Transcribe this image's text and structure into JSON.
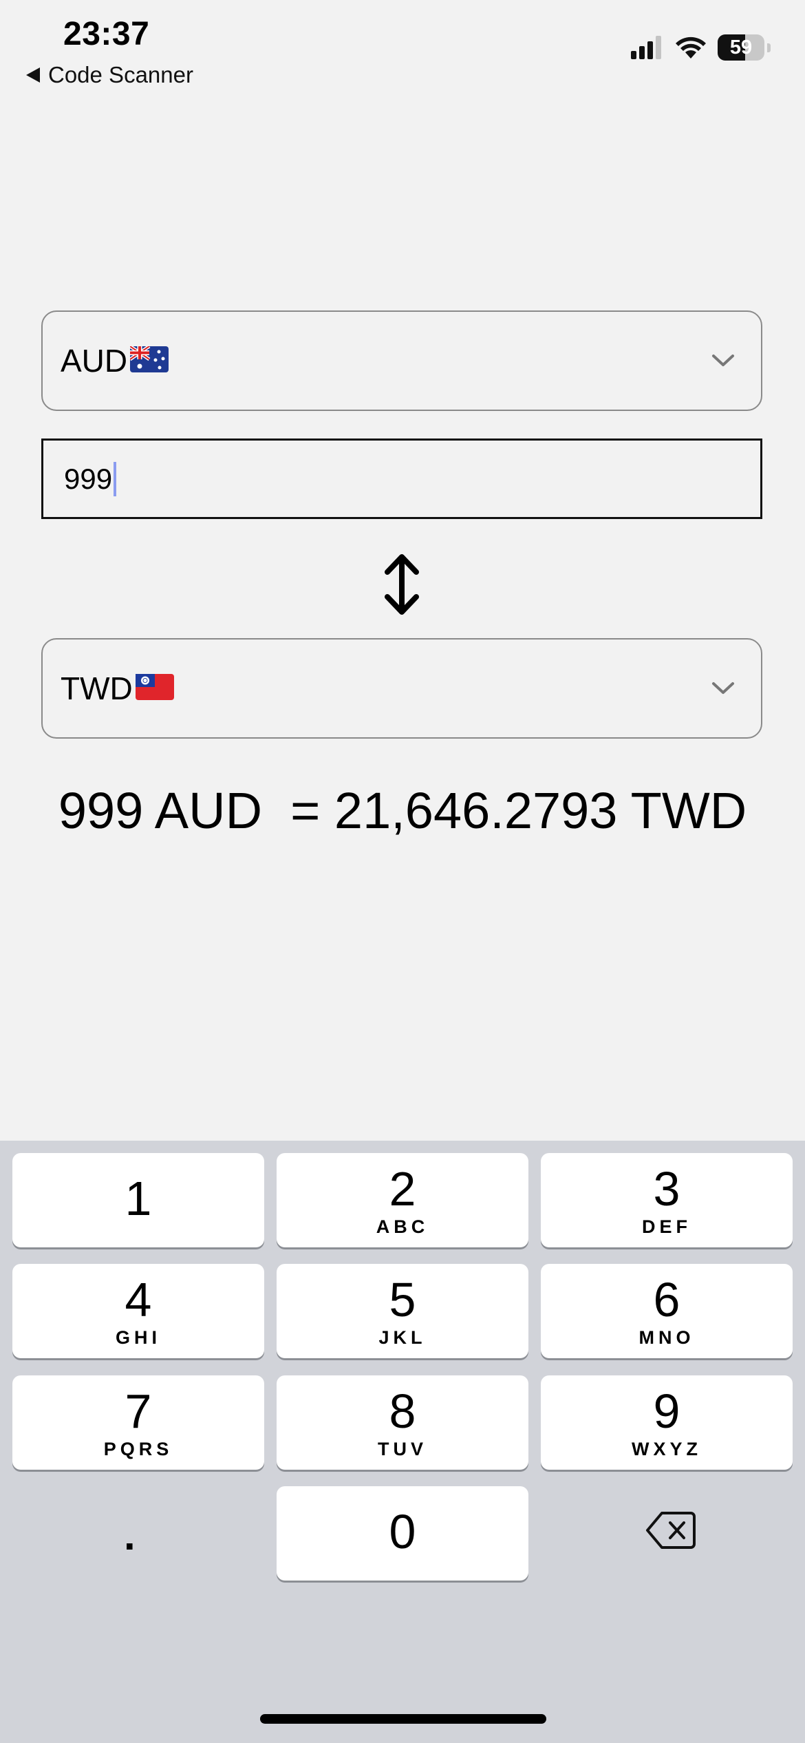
{
  "status_bar": {
    "time": "23:37",
    "back_label": "Code Scanner",
    "battery": "59",
    "battery_level": 0.59
  },
  "converter": {
    "from_currency": "AUD",
    "from_flag": "australia-flag",
    "amount_value": "999",
    "to_currency": "TWD",
    "to_flag": "taiwan-flag",
    "result": "999 AUD  = 21,646.2793 TWD"
  },
  "keyboard": {
    "keys": [
      {
        "digit": "1",
        "letters": ""
      },
      {
        "digit": "2",
        "letters": "ABC"
      },
      {
        "digit": "3",
        "letters": "DEF"
      },
      {
        "digit": "4",
        "letters": "GHI"
      },
      {
        "digit": "5",
        "letters": "JKL"
      },
      {
        "digit": "6",
        "letters": "MNO"
      },
      {
        "digit": "7",
        "letters": "PQRS"
      },
      {
        "digit": "8",
        "letters": "TUV"
      },
      {
        "digit": "9",
        "letters": "WXYZ"
      },
      {
        "digit": "0",
        "letters": ""
      }
    ],
    "dot": "."
  }
}
